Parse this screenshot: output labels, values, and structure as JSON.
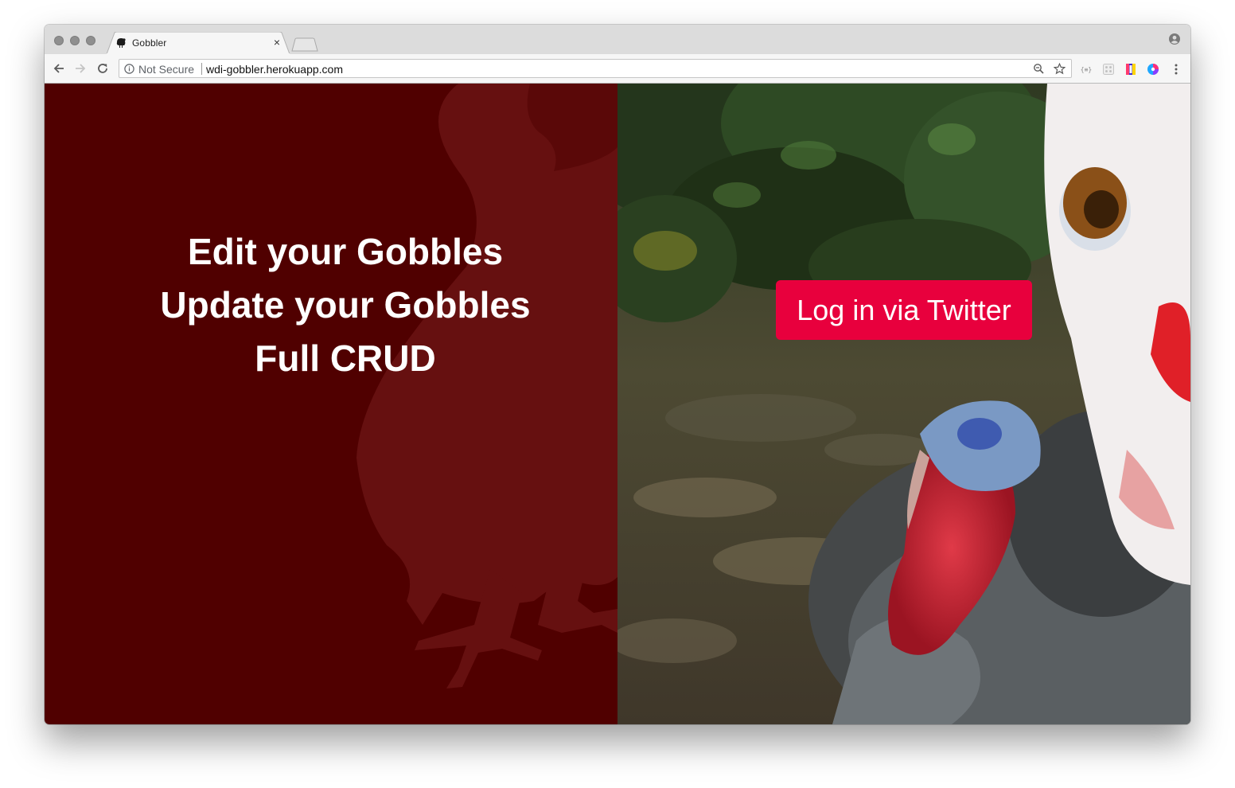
{
  "browser": {
    "tab": {
      "title": "Gobbler",
      "close_label": "×",
      "favicon": "turkey-icon"
    },
    "omnibox": {
      "security_label": "Not Secure",
      "url": "wdi-gobbler.herokuapp.com"
    },
    "icons": [
      "back-arrow-icon",
      "forward-arrow-icon",
      "reload-icon",
      "info-icon",
      "zoom-icon",
      "star-icon",
      "profile-icon",
      "menu-dots-icon"
    ]
  },
  "page": {
    "headlines": [
      "Edit your Gobbles",
      "Update your Gobbles",
      "Full CRUD"
    ],
    "login_button": "Log in via Twitter",
    "colors": {
      "left_panel": "#500000",
      "button": "#e8003d"
    }
  }
}
